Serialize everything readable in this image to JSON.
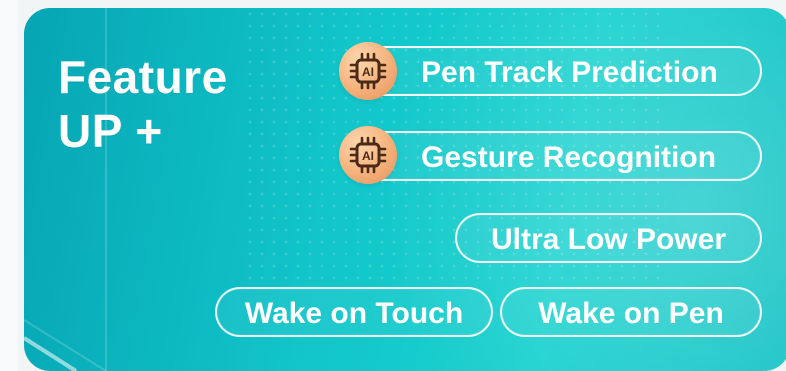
{
  "headline": {
    "line1": "Feature",
    "line2": "UP +"
  },
  "features": {
    "pen_track_prediction": "Pen Track Prediction",
    "gesture_recognition": "Gesture Recognition",
    "ultra_low_power": "Ultra Low Power",
    "wake_on_touch": "Wake on Touch",
    "wake_on_pen": "Wake on Pen"
  },
  "icons": {
    "ai_chip": "ai-chip-icon"
  },
  "colors": {
    "card_teal_dark": "#06a5b4",
    "card_teal_light": "#1bd2cf",
    "pill_border": "#ffffff",
    "ai_badge_orange": "#f4b17b",
    "ai_icon_dark": "#4c2b17"
  }
}
